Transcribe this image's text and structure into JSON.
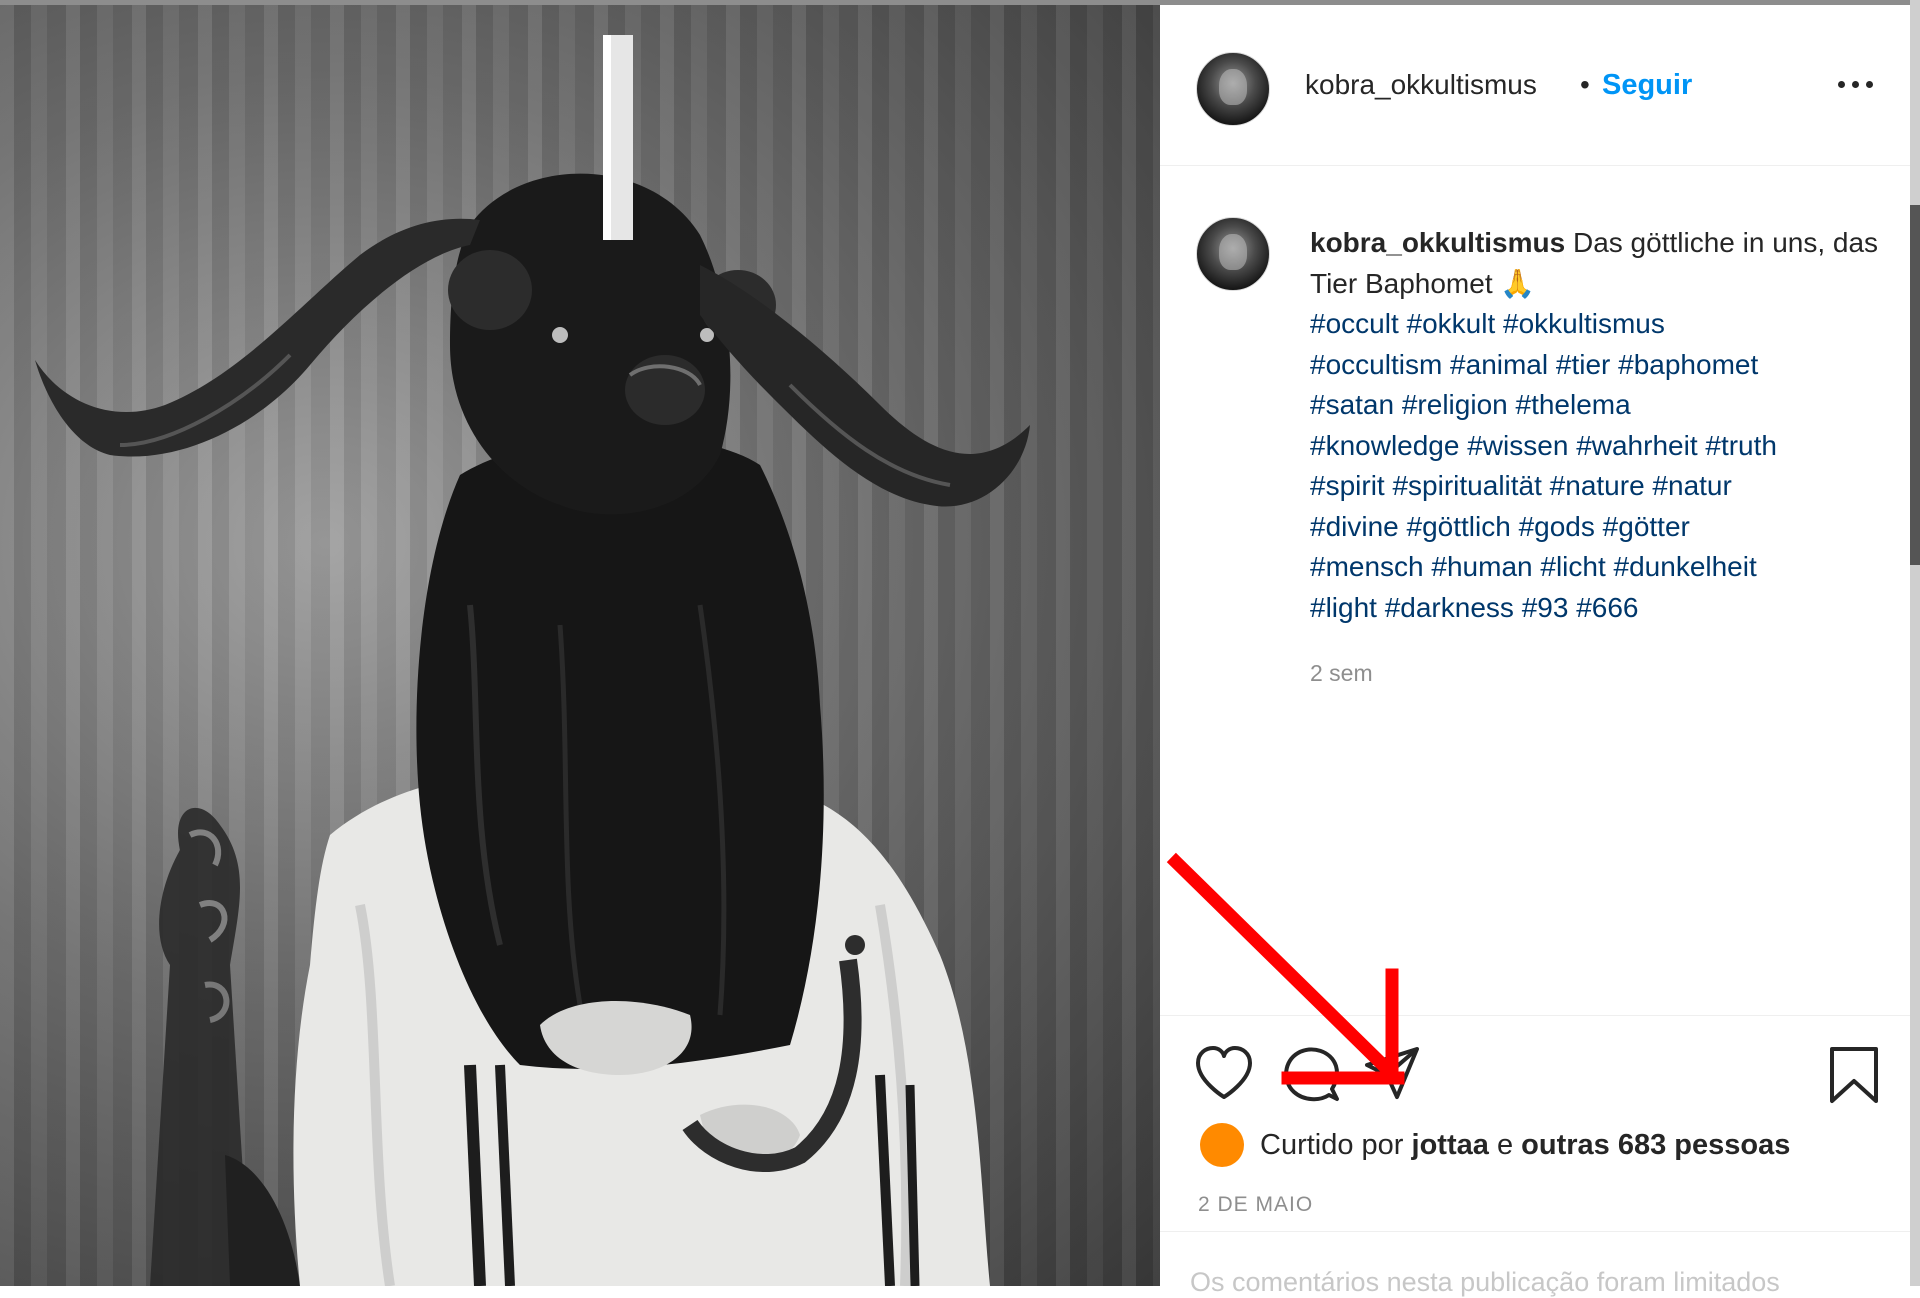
{
  "post": {
    "username": "kobra_okkultismus",
    "dot": "•",
    "follow_label": "Seguir",
    "caption_text": "Das göttliche in uns, das Tier Baphomet 🙏",
    "hashtags": [
      "#occult",
      "#okkult",
      "#okkultismus",
      "#occultism",
      "#animal",
      "#tier",
      "#baphomet",
      "#satan",
      "#religion",
      "#thelema",
      "#knowledge",
      "#wissen",
      "#wahrheit",
      "#truth",
      "#spirit",
      "#spiritualität",
      "#nature",
      "#natur",
      "#divine",
      "#göttlich",
      "#gods",
      "#götter",
      "#mensch",
      "#human",
      "#licht",
      "#dunkelheit",
      "#light",
      "#darkness",
      "#93",
      "#666"
    ],
    "time_ago": "2 sem",
    "likes_prefix": "Curtido por",
    "likes_user": "jottaa",
    "likes_middle": "e",
    "likes_others": "outras 683 pessoas",
    "date": "2 DE MAIO",
    "comment_hint": "Os comentários nesta publicação foram limitados"
  },
  "icons": {
    "more": "more-options-icon",
    "like": "heart-icon",
    "comment": "comment-bubble-icon",
    "share": "paper-plane-icon",
    "save": "bookmark-icon",
    "annotation": "red-arrow-annotation"
  },
  "colors": {
    "follow": "#0095f6",
    "hashtag": "#00376b",
    "muted": "#8e8e8e",
    "liker_avatar": "#ff8a00",
    "annotation": "#ff0000"
  }
}
